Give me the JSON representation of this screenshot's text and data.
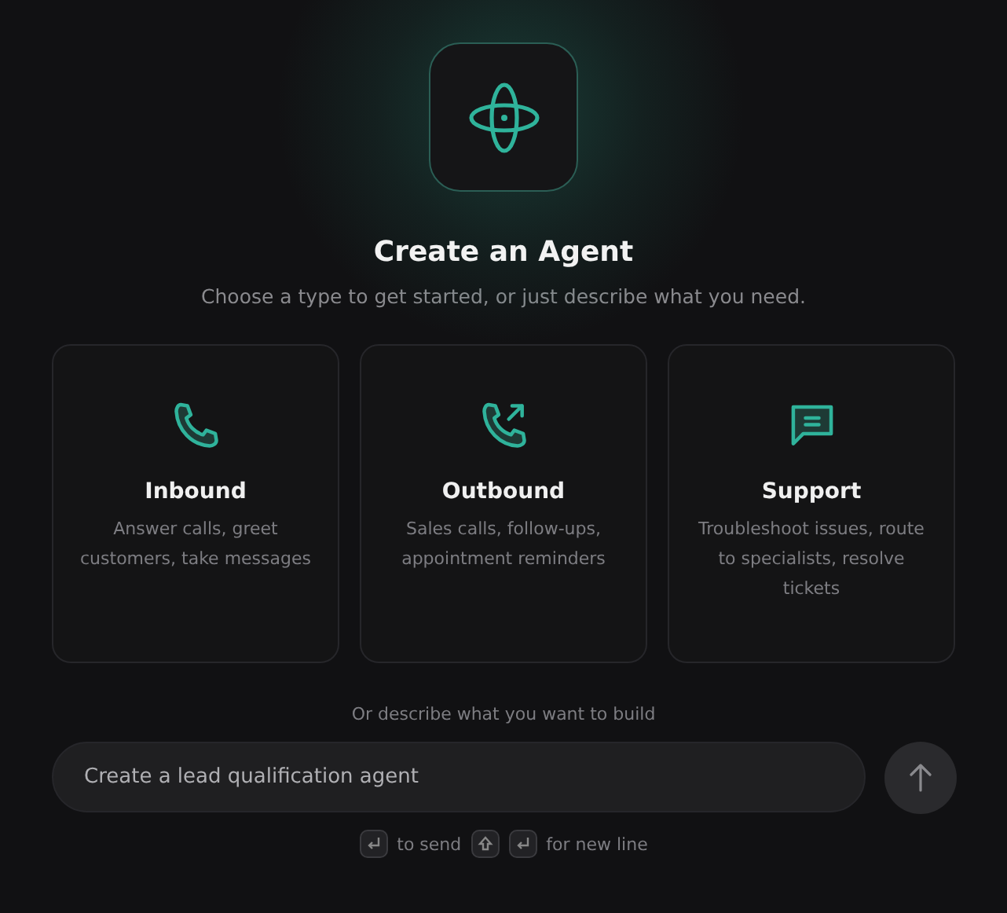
{
  "header": {
    "title": "Create an Agent",
    "subtitle": "Choose a type to get started, or just describe what you need."
  },
  "agent_types": [
    {
      "kind": "inbound",
      "title": "Inbound",
      "description": "Answer calls, greet customers, take messages"
    },
    {
      "kind": "outbound",
      "title": "Outbound",
      "description": "Sales calls, follow-ups, appointment reminders"
    },
    {
      "kind": "support",
      "title": "Support",
      "description": "Troubleshoot issues, route to specialists, resolve tickets"
    }
  ],
  "describe_label": "Or describe what you want to build",
  "prompt": {
    "placeholder": "Create a lead qualification agent"
  },
  "hints": {
    "send": "to send",
    "new_line": "for new line"
  }
}
